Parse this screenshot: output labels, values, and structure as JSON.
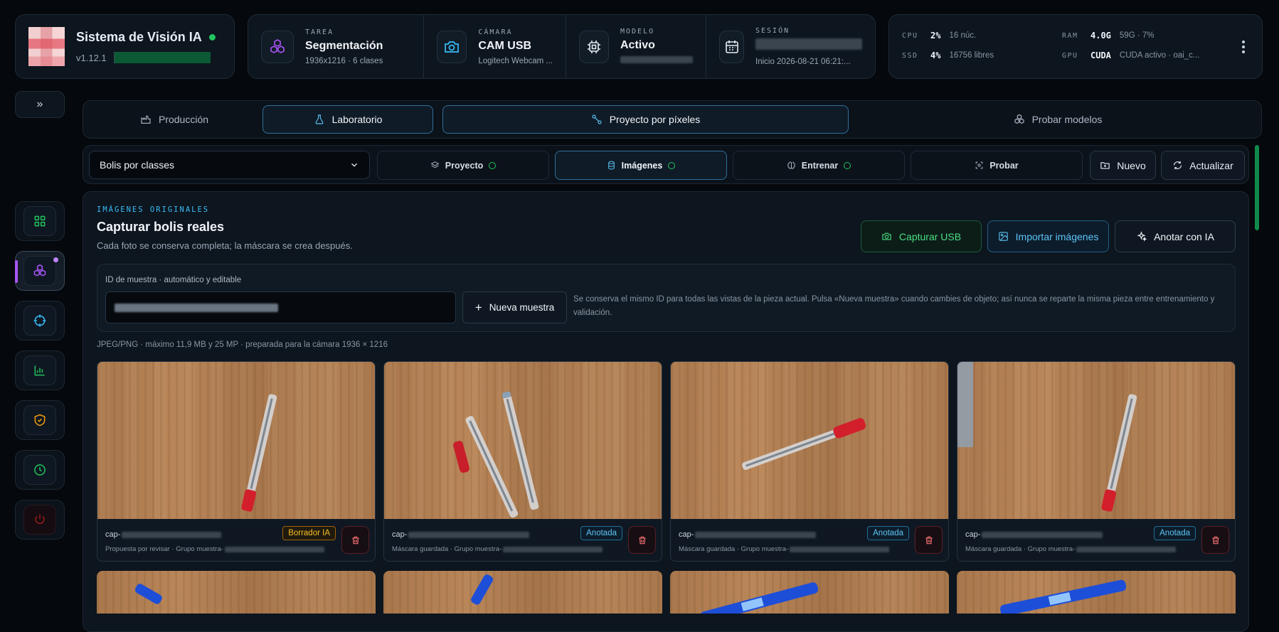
{
  "header": {
    "app_title": "Sistema de Visión IA",
    "version": "v1.12.1",
    "status": [
      {
        "caption": "TAREA",
        "value": "Segmentación",
        "sub": "1936x1216 · 6 clases",
        "icon": "cubes-icon"
      },
      {
        "caption": "CÁMARA",
        "value": "CAM USB",
        "sub": "Logitech Webcam ...",
        "icon": "camera-icon"
      },
      {
        "caption": "MODELO",
        "value": "Activo",
        "sub": "",
        "icon": "chip-icon"
      },
      {
        "caption": "SESIÓN",
        "value": "",
        "sub": "Inicio 2026-08-21 06:21:...",
        "icon": "calendar-icon"
      }
    ],
    "system": [
      {
        "key": "CPU",
        "value": "2%",
        "sub": "16 núc."
      },
      {
        "key": "RAM",
        "value": "4.0G",
        "sub": "59G · 7%"
      },
      {
        "key": "SSD",
        "value": "4%",
        "sub": "16756 libres"
      },
      {
        "key": "GPU",
        "value": "CUDA",
        "sub": "CUDA activo · oai_c..."
      }
    ]
  },
  "sidebar": {
    "collapse_label": "»",
    "items": [
      {
        "name": "grid-icon",
        "color": "#22c55e"
      },
      {
        "name": "cubes-icon",
        "color": "#a855f7"
      },
      {
        "name": "crosshair-icon",
        "color": "#38bdf8"
      },
      {
        "name": "bar-chart-icon",
        "color": "#22c55e"
      },
      {
        "name": "shield-icon",
        "color": "#f59e0b"
      },
      {
        "name": "clock-icon",
        "color": "#22c55e"
      },
      {
        "name": "power-icon",
        "color": "#7f1d1d"
      }
    ]
  },
  "modes": [
    {
      "label": "Producción"
    },
    {
      "label": "Laboratorio"
    },
    {
      "label": "Proyecto por píxeles"
    },
    {
      "label": "Probar modelos"
    }
  ],
  "subbar": {
    "project_select": "Bolis por classes",
    "tabs": [
      {
        "label": "Proyecto"
      },
      {
        "label": "Imágenes"
      },
      {
        "label": "Entrenar"
      },
      {
        "label": "Probar"
      }
    ],
    "new_label": "Nuevo",
    "refresh_label": "Actualizar"
  },
  "main": {
    "eyebrow": "IMÁGENES ORIGINALES",
    "title": "Capturar bolis reales",
    "description": "Cada foto se conserva completa; la máscara se crea después.",
    "actions": {
      "capture": "Capturar USB",
      "import": "Importar imágenes",
      "annotate": "Anotar con IA"
    },
    "sample": {
      "label": "ID de muestra · automático y editable",
      "new_button": "Nueva muestra",
      "note": "Se conserva el mismo ID para todas las vistas de la pieza actual. Pulsa «Nueva muestra» cuando cambies de objeto; así nunca se reparte la misma pieza entre entrenamiento y validación."
    },
    "format_note": "JPEG/PNG · máximo 11,9 MB y 25 MP · preparada para la cámara 1936 × 1216",
    "cards": [
      {
        "cap_prefix": "cap-",
        "badge": "Borrador IA",
        "badge_type": "draft",
        "meta": "Propuesta por revisar · Grupo muestra-"
      },
      {
        "cap_prefix": "cap-",
        "badge": "Anotada",
        "badge_type": "ann",
        "meta": "Máscara guardada · Grupo muestra-"
      },
      {
        "cap_prefix": "cap-",
        "badge": "Anotada",
        "badge_type": "ann",
        "meta": "Máscara guardada · Grupo muestra-"
      },
      {
        "cap_prefix": "cap-",
        "badge": "Anotada",
        "badge_type": "ann",
        "meta": "Máscara guardada · Grupo muestra-"
      }
    ]
  }
}
